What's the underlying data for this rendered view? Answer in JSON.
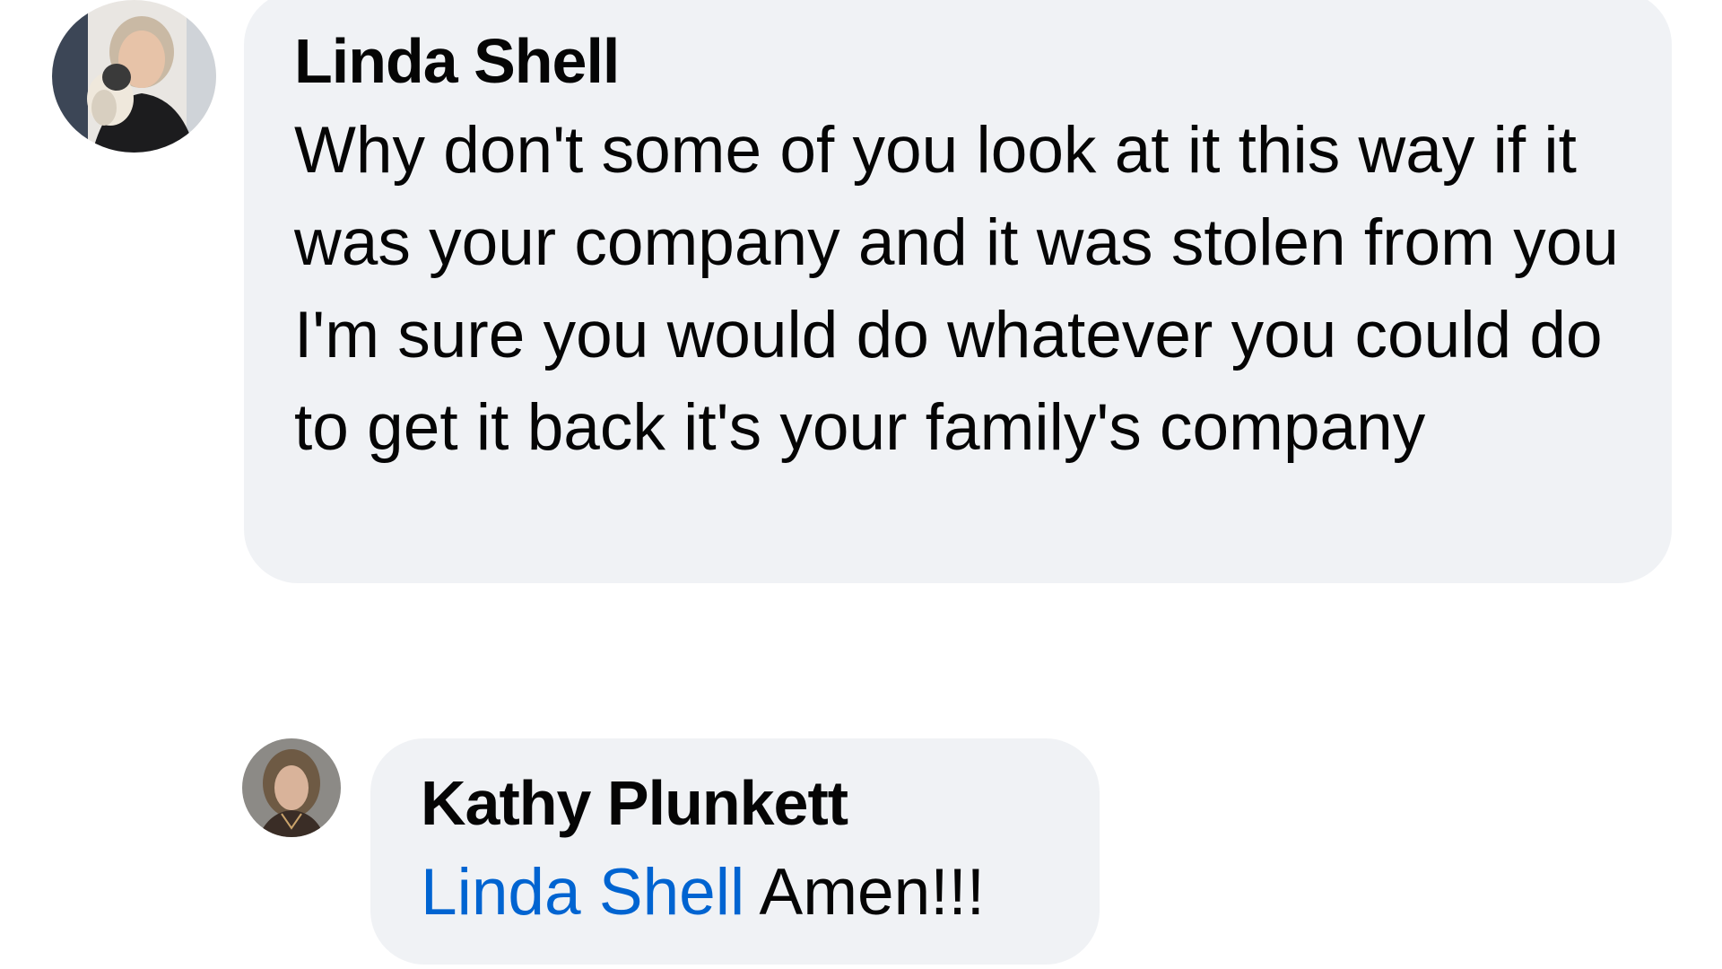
{
  "comments": [
    {
      "author": "Linda Shell",
      "text": "Why don't some of you look at it this way if it was your company and it was stolen from you I'm sure you would do whatever you could do to get it back it's your family's company",
      "avatar_icon": "profile-photo-woman-with-dog"
    },
    {
      "author": "Kathy Plunkett",
      "mention": "Linda Shell",
      "text": "Amen!!!",
      "avatar_icon": "profile-photo-woman"
    }
  ],
  "colors": {
    "bubble_background": "#f0f2f5",
    "mention_link": "#0064d1",
    "text": "#050505"
  }
}
